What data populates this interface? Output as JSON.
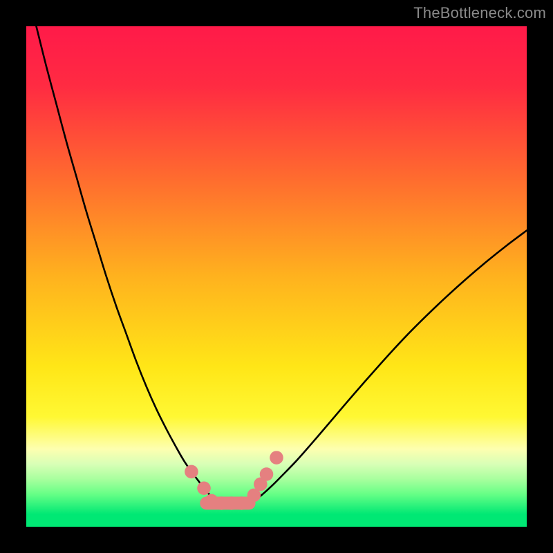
{
  "watermark": "TheBottleneck.com",
  "chart_data": {
    "type": "line",
    "title": "",
    "xlabel": "",
    "ylabel": "",
    "xlim": [
      0,
      100
    ],
    "ylim": [
      0,
      100
    ],
    "gradient_stops": [
      {
        "offset": 0.0,
        "color": "#ff1a49"
      },
      {
        "offset": 0.12,
        "color": "#ff2b42"
      },
      {
        "offset": 0.3,
        "color": "#ff6a2f"
      },
      {
        "offset": 0.5,
        "color": "#ffb21e"
      },
      {
        "offset": 0.68,
        "color": "#ffe617"
      },
      {
        "offset": 0.78,
        "color": "#fff833"
      },
      {
        "offset": 0.845,
        "color": "#fdffb0"
      },
      {
        "offset": 0.875,
        "color": "#d8ffb6"
      },
      {
        "offset": 0.905,
        "color": "#a8ff9e"
      },
      {
        "offset": 0.935,
        "color": "#66ff86"
      },
      {
        "offset": 0.975,
        "color": "#00e874"
      },
      {
        "offset": 1.0,
        "color": "#00e874"
      }
    ],
    "series": [
      {
        "name": "left-curve",
        "x": [
          2,
          4,
          6,
          8,
          10,
          12,
          14,
          16,
          18,
          20,
          22,
          24,
          26,
          28,
          30,
          31.5,
          33,
          34.3,
          35.5,
          37,
          38.5
        ],
        "y": [
          100,
          92,
          84.5,
          77,
          70,
          63,
          56.5,
          50,
          44,
          38.5,
          33,
          28,
          23.5,
          19.5,
          15.8,
          13.2,
          11,
          9.3,
          7.7,
          6,
          4.7
        ]
      },
      {
        "name": "right-curve",
        "x": [
          45,
          47,
          49,
          51,
          54,
          57,
          60,
          64,
          68,
          72,
          76,
          80,
          84,
          88,
          92,
          96,
          100
        ],
        "y": [
          4.7,
          6.3,
          8.1,
          10.1,
          13.2,
          16.6,
          20.1,
          24.8,
          29.4,
          33.9,
          38.2,
          42.2,
          46.0,
          49.6,
          53.0,
          56.2,
          59.2
        ]
      }
    ],
    "markers": {
      "name": "salmon-dots",
      "color": "#e58080",
      "radius_pct": 1.35,
      "points": [
        {
          "x": 33.0,
          "y": 11.0
        },
        {
          "x": 35.5,
          "y": 7.7
        },
        {
          "x": 37.0,
          "y": 5.2
        },
        {
          "x": 39.0,
          "y": 4.7
        },
        {
          "x": 41.0,
          "y": 4.7
        },
        {
          "x": 43.0,
          "y": 4.7
        },
        {
          "x": 45.5,
          "y": 6.3
        },
        {
          "x": 46.8,
          "y": 8.5
        },
        {
          "x": 48.0,
          "y": 10.5
        },
        {
          "x": 50.0,
          "y": 13.8
        }
      ]
    },
    "flat_segment": {
      "name": "salmon-flat",
      "color": "#e58080",
      "thickness_pct": 2.6,
      "x_start": 36.0,
      "x_end": 44.5,
      "y": 4.7
    }
  }
}
